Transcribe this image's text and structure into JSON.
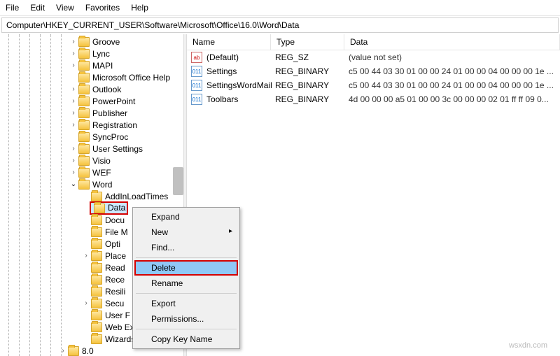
{
  "menu": {
    "file": "File",
    "edit": "Edit",
    "view": "View",
    "favorites": "Favorites",
    "help": "Help"
  },
  "address": "Computer\\HKEY_CURRENT_USER\\Software\\Microsoft\\Office\\16.0\\Word\\Data",
  "tree": {
    "groove": "Groove",
    "lync": "Lync",
    "mapi": "MAPI",
    "moh": "Microsoft Office Help",
    "outlook": "Outlook",
    "powerpoint": "PowerPoint",
    "publisher": "Publisher",
    "registration": "Registration",
    "syncproc": "SyncProc",
    "usersettings": "User Settings",
    "visio": "Visio",
    "wef": "WEF",
    "word": "Word",
    "addin": "AddInLoadTimes",
    "data": "Data",
    "docu": "Docu",
    "filem": "File M",
    "opti": "Opti",
    "place": "Place",
    "read": "Read",
    "rece": "Rece",
    "resili": "Resili",
    "secu": "Secu",
    "userf": "User F",
    "webext": "Web Extension List",
    "wizards": "Wizards",
    "eight": "8.0"
  },
  "cols": {
    "name": "Name",
    "type": "Type",
    "data": "Data"
  },
  "rows": [
    {
      "icon": "str",
      "name": "(Default)",
      "type": "REG_SZ",
      "data": "(value not set)"
    },
    {
      "icon": "bin",
      "name": "Settings",
      "type": "REG_BINARY",
      "data": "c5 00 44 03 30 01 00 00 24 01 00 00 04 00 00 00 1e ..."
    },
    {
      "icon": "bin",
      "name": "SettingsWordMail",
      "type": "REG_BINARY",
      "data": "c5 00 44 03 30 01 00 00 24 01 00 00 04 00 00 00 1e ..."
    },
    {
      "icon": "bin",
      "name": "Toolbars",
      "type": "REG_BINARY",
      "data": "4d 00 00 00 a5 01 00 00 3c 00 00 00 02 01 ff ff 09 0..."
    }
  ],
  "ctx": {
    "expand": "Expand",
    "new": "New",
    "find": "Find...",
    "delete": "Delete",
    "rename": "Rename",
    "export": "Export",
    "permissions": "Permissions...",
    "copy": "Copy Key Name"
  },
  "watermark": "wsxdn.com"
}
